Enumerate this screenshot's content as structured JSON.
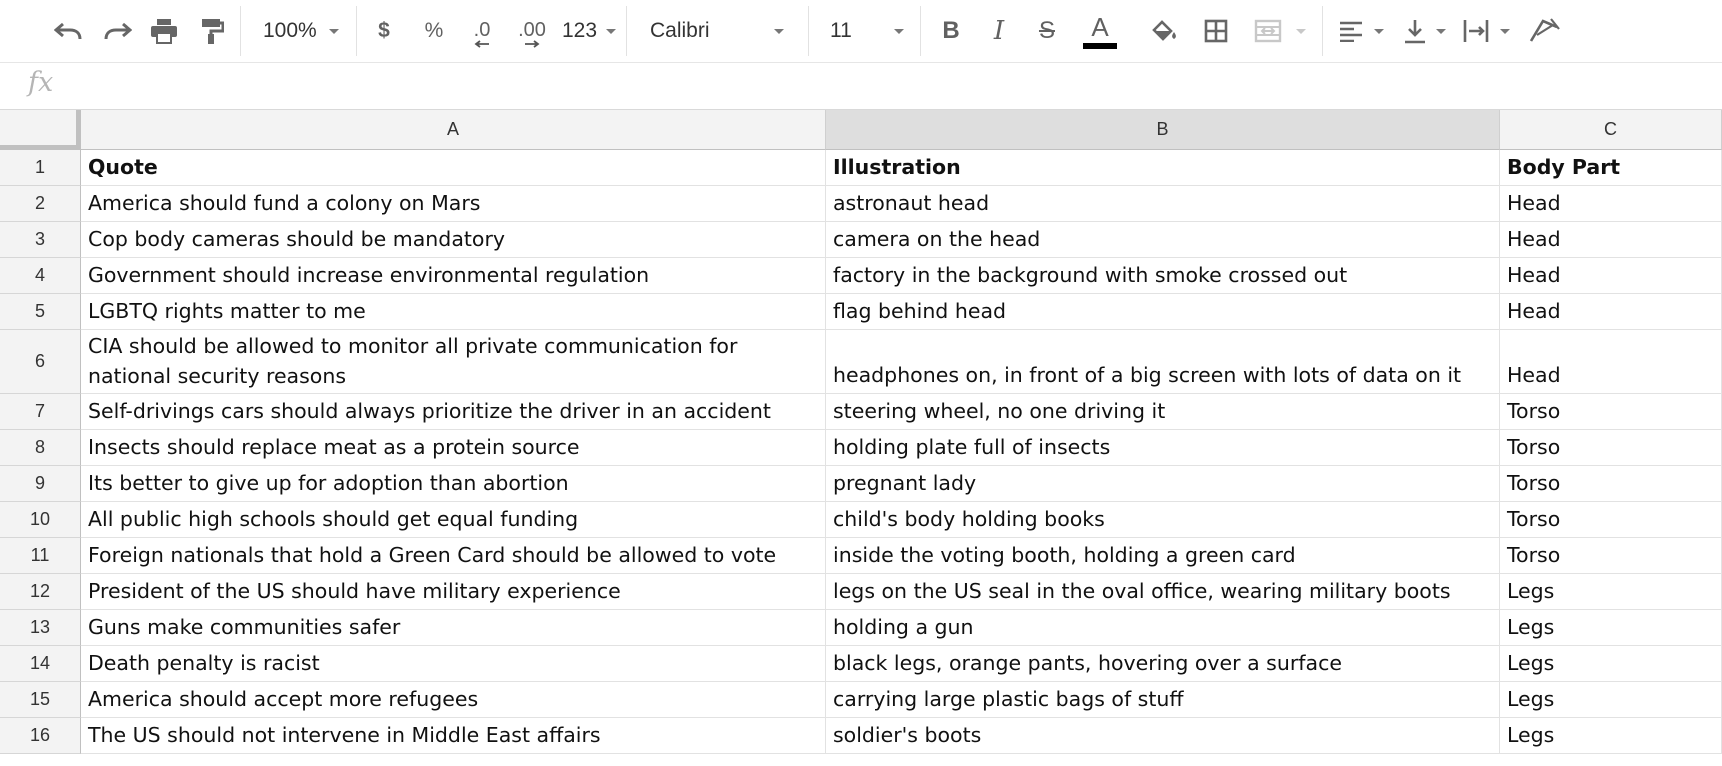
{
  "toolbar": {
    "zoom": "100%",
    "currency_label": "$",
    "percent_label": "%",
    "decrease_decimal_label": ".0",
    "increase_decimal_label": ".00",
    "format_label": "123",
    "font_name": "Calibri",
    "font_size": "11",
    "text_color": "#000000",
    "icons": [
      "undo-icon",
      "redo-icon",
      "print-icon",
      "paint-format-icon",
      "bold-icon",
      "italic-icon",
      "strikethrough-icon",
      "text-color-icon",
      "fill-color-icon",
      "borders-icon",
      "merge-cells-icon",
      "horizontal-align-icon",
      "vertical-align-icon",
      "text-wrap-icon",
      "text-rotation-icon"
    ]
  },
  "formula_bar": {
    "fx_label": "fx",
    "value": ""
  },
  "sheet": {
    "columns": [
      "A",
      "B",
      "C"
    ],
    "rows": [
      {
        "num": "1",
        "a": "Quote",
        "b": "Illustration",
        "c": "Body Part"
      },
      {
        "num": "2",
        "a": "America should fund a colony on Mars",
        "b": "astronaut head",
        "c": "Head"
      },
      {
        "num": "3",
        "a": "Cop body cameras should be mandatory",
        "b": "camera on the head",
        "c": "Head"
      },
      {
        "num": "4",
        "a": "Government should increase environmental regulation",
        "b": "factory in the background with smoke crossed out",
        "c": "Head"
      },
      {
        "num": "5",
        "a": "LGBTQ rights matter to me",
        "b": "flag behind head",
        "c": "Head"
      },
      {
        "num": "6",
        "a": "CIA should be allowed to monitor all private communication for national security reasons",
        "b": "headphones on, in front of a big screen with lots of data on it",
        "c": "Head"
      },
      {
        "num": "7",
        "a": "Self-drivings cars should always prioritize the driver in an accident",
        "b": "steering wheel, no one driving it",
        "c": "Torso"
      },
      {
        "num": "8",
        "a": "Insects should replace meat as a protein source",
        "b": "holding plate full of insects",
        "c": "Torso"
      },
      {
        "num": "9",
        "a": "Its better to give up for adoption than abortion",
        "b": "pregnant lady",
        "c": "Torso"
      },
      {
        "num": "10",
        "a": "All public high schools should get equal funding",
        "b": "child's body holding books",
        "c": "Torso"
      },
      {
        "num": "11",
        "a": "Foreign nationals that hold a Green Card should be allowed to vote",
        "b": "inside the voting booth, holding a green card",
        "c": "Torso"
      },
      {
        "num": "12",
        "a": "President of the US should have military experience",
        "b": "legs on the US seal in the oval office, wearing military boots",
        "c": "Legs"
      },
      {
        "num": "13",
        "a": "Guns make communities safer",
        "b": "holding a gun",
        "c": "Legs"
      },
      {
        "num": "14",
        "a": "Death penalty is racist",
        "b": "black legs, orange pants, hovering over a surface",
        "c": "Legs"
      },
      {
        "num": "15",
        "a": "America should accept more refugees",
        "b": "carrying large plastic bags of stuff",
        "c": "Legs"
      },
      {
        "num": "16",
        "a": "The US should not intervene in Middle East affairs",
        "b": "soldier's boots",
        "c": "Legs"
      }
    ]
  }
}
